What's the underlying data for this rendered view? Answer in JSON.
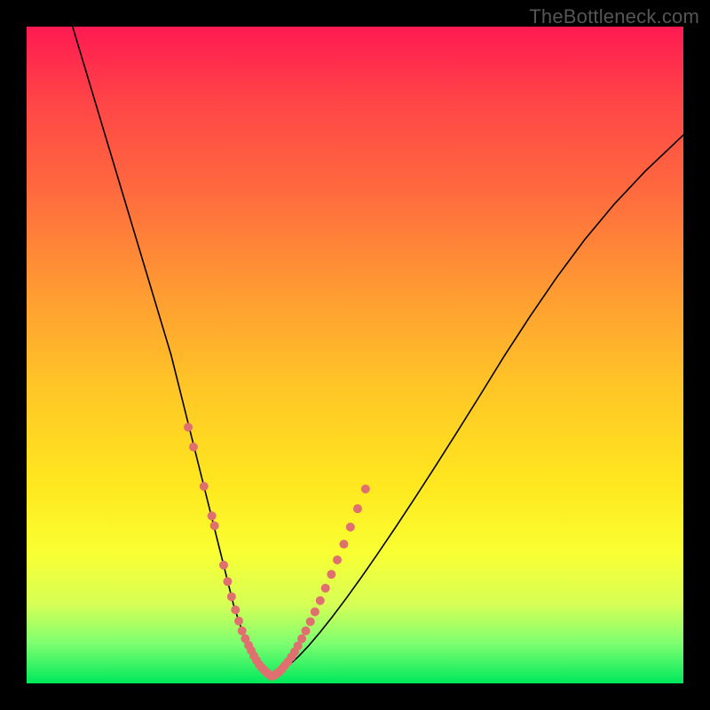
{
  "watermark": "TheBottleneck.com",
  "chart_data": {
    "type": "line",
    "title": "",
    "xlabel": "",
    "ylabel": "",
    "xlim": [
      0,
      100
    ],
    "ylim": [
      0,
      100
    ],
    "grid": false,
    "legend": false,
    "series": [
      {
        "name": "curve-left",
        "x": [
          7,
          10,
          13,
          16,
          19,
          22,
          24,
          26,
          28,
          29.5,
          30.5,
          31.5,
          32.3,
          33,
          33.7,
          34.4,
          35,
          35.6,
          36.2,
          36.8,
          37.3
        ],
        "y": [
          100,
          90,
          80,
          70,
          60,
          50,
          42,
          34,
          26,
          20,
          16,
          12,
          9.5,
          7.5,
          5.8,
          4.5,
          3.5,
          2.7,
          2.0,
          1.5,
          1.1
        ]
      },
      {
        "name": "curve-right",
        "x": [
          37.3,
          38,
          39,
          40.2,
          41.5,
          43,
          44.7,
          46.6,
          48.7,
          51,
          53.5,
          56.2,
          59.1,
          62.2,
          65.5,
          69,
          72.7,
          76.6,
          80.7,
          85,
          89.5,
          94.2,
          100
        ],
        "y": [
          1.1,
          1.4,
          2.0,
          3.0,
          4.2,
          5.8,
          7.8,
          10.2,
          13.0,
          16.2,
          19.8,
          23.8,
          28.2,
          33.0,
          38.2,
          43.8,
          49.8,
          55.8,
          61.8,
          67.6,
          73.0,
          78.0,
          83.5
        ]
      }
    ],
    "markers": [
      {
        "name": "dots-left",
        "x": [
          24.6,
          25.4,
          27.0,
          28.2,
          28.6,
          30.0,
          30.6,
          31.2,
          31.8,
          32.3,
          32.8,
          33.3,
          33.8,
          34.2,
          34.6,
          35.0,
          35.4,
          35.8,
          36.2,
          36.6,
          37.0,
          37.3
        ],
        "y": [
          39.0,
          36.0,
          30.0,
          25.5,
          24.0,
          18.0,
          15.5,
          13.2,
          11.2,
          9.5,
          8.0,
          6.8,
          5.8,
          5.0,
          4.2,
          3.5,
          2.9,
          2.4,
          2.0,
          1.6,
          1.3,
          1.1
        ],
        "r": 5,
        "color": "#e07070"
      },
      {
        "name": "dots-right",
        "x": [
          37.7,
          38.1,
          38.5,
          38.9,
          39.3,
          39.8,
          40.3,
          40.8,
          41.3,
          41.9,
          42.5,
          43.2,
          43.9,
          44.7,
          45.5,
          46.4,
          47.3,
          48.3,
          49.3,
          50.4,
          51.6
        ],
        "y": [
          1.2,
          1.5,
          1.8,
          2.2,
          2.7,
          3.3,
          4.0,
          4.8,
          5.7,
          6.8,
          8.0,
          9.4,
          10.9,
          12.6,
          14.5,
          16.6,
          18.8,
          21.2,
          23.8,
          26.6,
          29.6
        ],
        "r": 5,
        "color": "#e07070"
      }
    ]
  }
}
